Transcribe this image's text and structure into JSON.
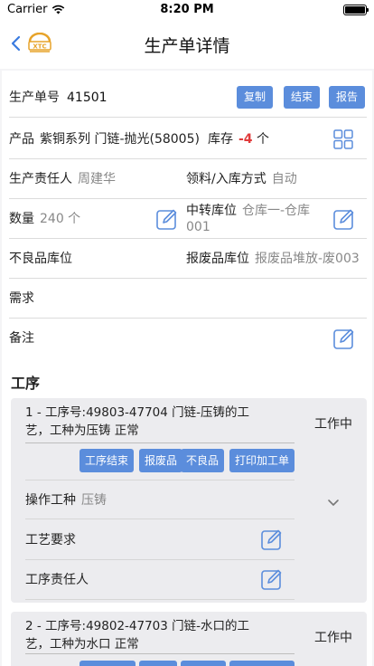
{
  "status_bar": {
    "carrier": "Carrier",
    "time": "8:20 PM"
  },
  "nav": {
    "title": "生产单详情",
    "logo_text": "XTC"
  },
  "order": {
    "number_label": "生产单号",
    "number_value": "41501",
    "buttons": {
      "copy": "复制",
      "close": "结束",
      "report": "报告"
    },
    "product_label": "产品",
    "product_value": "紫铜系列 门链-抛光(58005)",
    "stock_label": "库存",
    "stock_value": "-4",
    "stock_unit": "个",
    "owner_label": "生产责任人",
    "owner_value": "周建华",
    "method_label": "领料/入库方式",
    "method_value": "自动",
    "quantity_label": "数量",
    "quantity_value": "240 个",
    "transfer_label": "中转库位",
    "transfer_value": "仓库一-仓库001",
    "defect_label": "不良品库位",
    "scrap_label": "报废品库位",
    "scrap_value": "报废品堆放-废003",
    "demand_label": "需求",
    "remark_label": "备注"
  },
  "process_section_title": "工序",
  "processes": [
    {
      "title": "1 - 工序号:49803-47704 门链-压铸的工艺，工种为压铸  正常",
      "status": "工作中",
      "buttons": [
        "工序结束",
        "报废品",
        "不良品",
        "打印加工单"
      ],
      "worktype_label": "操作工种",
      "worktype_value": "压铸",
      "requirement_label": "工艺要求",
      "owner_label": "工序责任人"
    },
    {
      "title": "2 - 工序号:49802-47703 门链-水口的工艺，工种为水口  正常",
      "status": "工作中"
    }
  ],
  "colors": {
    "accent": "#5b8ddc",
    "negative": "#e03b3b",
    "background": "#f4f4f6"
  }
}
